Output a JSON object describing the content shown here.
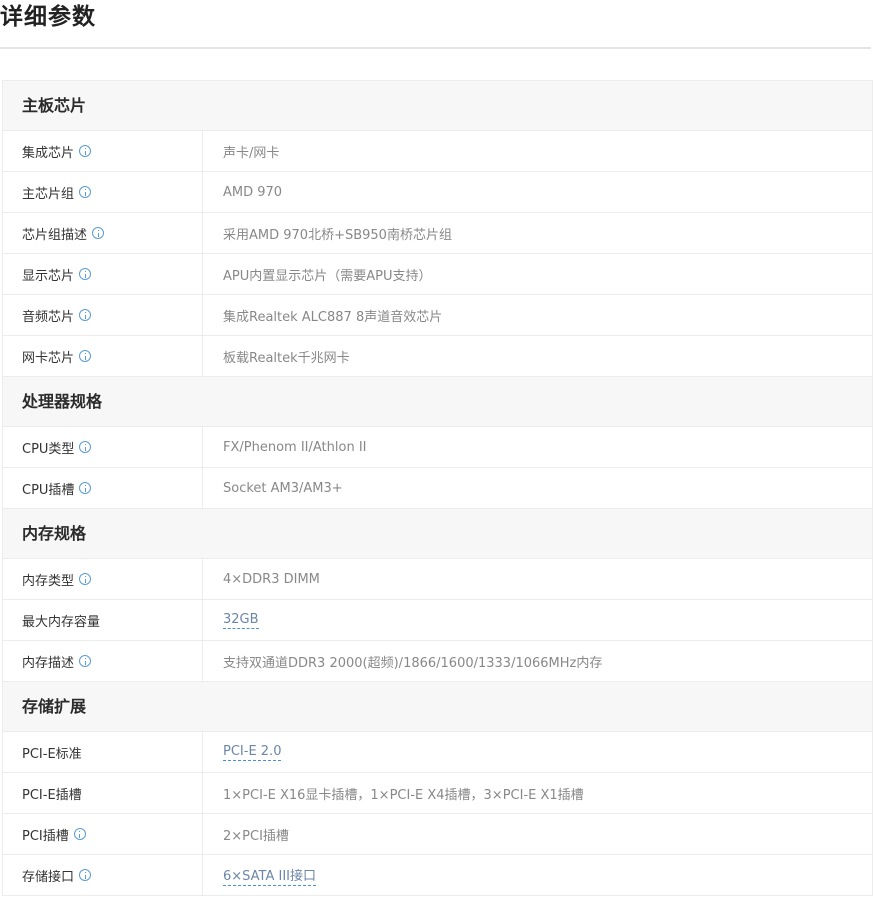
{
  "page": {
    "title": "详细参数"
  },
  "colors": {
    "section_bg": "#f7f7f7",
    "border": "#ececec",
    "label_text": "#333333",
    "value_text": "#888888",
    "info_icon": "#5b9bd5",
    "link_underline": "#4a90d9"
  },
  "sections": [
    {
      "title": "主板芯片",
      "rows": [
        {
          "label": "集成芯片",
          "value": "声卡/网卡",
          "info_icon": "info-circle-icon",
          "link": false
        },
        {
          "label": "主芯片组",
          "value": "AMD 970",
          "info_icon": "info-circle-icon",
          "link": false
        },
        {
          "label": "芯片组描述",
          "value": "采用AMD 970北桥+SB950南桥芯片组",
          "info_icon": "info-circle-icon",
          "link": false
        },
        {
          "label": "显示芯片",
          "value": "APU内置显示芯片（需要APU支持）",
          "info_icon": "info-circle-icon",
          "link": false
        },
        {
          "label": "音频芯片",
          "value": "集成Realtek ALC887 8声道音效芯片",
          "info_icon": "info-circle-icon",
          "link": false
        },
        {
          "label": "网卡芯片",
          "value": "板载Realtek千兆网卡",
          "info_icon": "info-circle-icon",
          "link": false
        }
      ]
    },
    {
      "title": "处理器规格",
      "rows": [
        {
          "label": "CPU类型",
          "value": "FX/Phenom II/Athlon II",
          "info_icon": "info-circle-icon",
          "link": false
        },
        {
          "label": "CPU插槽",
          "value": "Socket AM3/AM3+",
          "info_icon": "info-circle-icon",
          "link": false
        }
      ]
    },
    {
      "title": "内存规格",
      "rows": [
        {
          "label": "内存类型",
          "value": "4×DDR3 DIMM",
          "info_icon": "info-circle-icon",
          "link": false
        },
        {
          "label": "最大内存容量",
          "value": "32GB",
          "info_icon": "",
          "link": true
        },
        {
          "label": "内存描述",
          "value": "支持双通道DDR3 2000(超频)/1866/1600/1333/1066MHz内存",
          "info_icon": "info-circle-icon",
          "link": false
        }
      ]
    },
    {
      "title": "存储扩展",
      "rows": [
        {
          "label": "PCI-E标准",
          "value": "PCI-E 2.0",
          "info_icon": "",
          "link": true
        },
        {
          "label": "PCI-E插槽",
          "value": "1×PCI-E X16显卡插槽，1×PCI-E X4插槽，3×PCI-E X1插槽",
          "info_icon": "",
          "link": false
        },
        {
          "label": "PCI插槽",
          "value": "2×PCI插槽",
          "info_icon": "info-circle-icon",
          "link": false
        },
        {
          "label": "存储接口",
          "value": "6×SATA III接口",
          "info_icon": "info-circle-icon",
          "link": true
        }
      ]
    }
  ]
}
